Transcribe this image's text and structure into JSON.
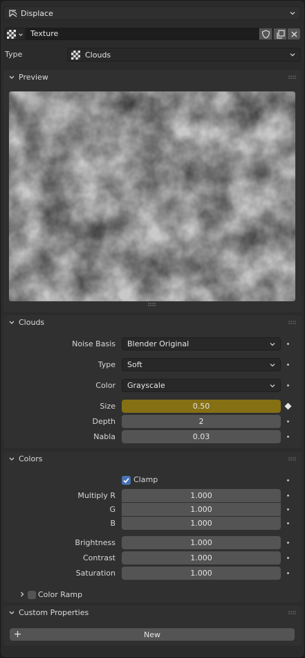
{
  "modifier": {
    "name": "Displace"
  },
  "texture_block": {
    "name": "Texture"
  },
  "type_row": {
    "label": "Type",
    "value": "Clouds"
  },
  "preview": {
    "title": "Preview"
  },
  "clouds": {
    "title": "Clouds",
    "noise_basis": {
      "label": "Noise Basis",
      "value": "Blender Original"
    },
    "type": {
      "label": "Type",
      "value": "Soft"
    },
    "color": {
      "label": "Color",
      "value": "Grayscale"
    },
    "size": {
      "label": "Size",
      "value": "0.50",
      "keyed_color": "#857014"
    },
    "depth": {
      "label": "Depth",
      "value": "2"
    },
    "nabla": {
      "label": "Nabla",
      "value": "0.03"
    }
  },
  "colors": {
    "title": "Colors",
    "clamp": {
      "label": "Clamp",
      "checked": true
    },
    "multiply_r": {
      "label": "Multiply R",
      "value": "1.000"
    },
    "g": {
      "label": "G",
      "value": "1.000"
    },
    "b": {
      "label": "B",
      "value": "1.000"
    },
    "brightness": {
      "label": "Brightness",
      "value": "1.000"
    },
    "contrast": {
      "label": "Contrast",
      "value": "1.000"
    },
    "saturation": {
      "label": "Saturation",
      "value": "1.000"
    },
    "color_ramp": {
      "label": "Color Ramp",
      "enabled": false
    }
  },
  "custom_properties": {
    "title": "Custom Properties",
    "new_label": "New"
  },
  "theme": {
    "accent": "#4772b3",
    "panel": "#303030",
    "field": "#545454",
    "dropdown": "#282828"
  }
}
